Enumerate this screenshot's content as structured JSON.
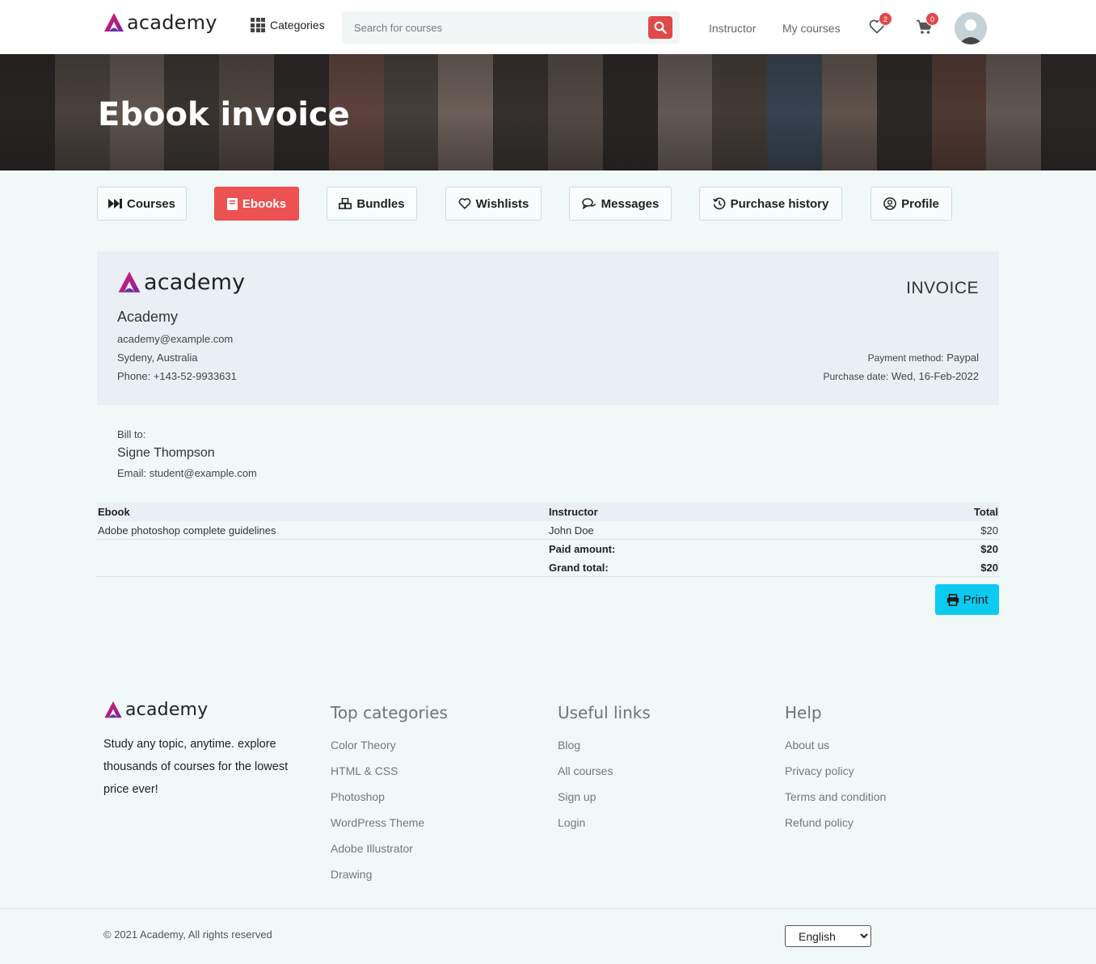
{
  "brand": {
    "name": "academy",
    "logo_colors": [
      "#c2185b",
      "#7b1fa2"
    ]
  },
  "header": {
    "categories_label": "Categories",
    "search_placeholder": "Search for courses",
    "instructor_link": "Instructor",
    "my_courses_link": "My courses",
    "wishlist_count": "2",
    "cart_count": "0"
  },
  "banner": {
    "title": "Ebook invoice"
  },
  "tabs": [
    {
      "label": "Courses"
    },
    {
      "label": "Ebooks",
      "active": true
    },
    {
      "label": "Bundles"
    },
    {
      "label": "Wishlists"
    },
    {
      "label": "Messages"
    },
    {
      "label": "Purchase history"
    },
    {
      "label": "Profile"
    }
  ],
  "invoice": {
    "title": "INVOICE",
    "company": "Academy",
    "email": "academy@example.com",
    "address": "Sydeny, Australia",
    "phone": "Phone: +143-52-9933631",
    "payment_method_label": "Payment method:",
    "payment_method": "Paypal",
    "purchase_date_label": "Purchase date:",
    "purchase_date": "Wed, 16-Feb-2022",
    "bill_to_label": "Bill to:",
    "bill_name": "Signe Thompson",
    "bill_email": "Email: student@example.com",
    "table": {
      "headers": [
        "Ebook",
        "Instructor",
        "Total"
      ],
      "rows": [
        [
          "Adobe photoshop complete guidelines",
          "John Doe",
          "$20"
        ]
      ],
      "paid_label": "Paid amount:",
      "paid_value": "$20",
      "grand_label": "Grand total:",
      "grand_value": "$20"
    },
    "print_label": "Print"
  },
  "footer": {
    "about": "Study any topic, anytime. explore thousands of courses for the lowest price ever!",
    "top_categories": {
      "title": "Top categories",
      "links": [
        "Color Theory",
        "HTML & CSS",
        "Photoshop",
        "WordPress Theme",
        "Adobe Illustrator",
        "Drawing"
      ]
    },
    "useful_links": {
      "title": "Useful links",
      "links": [
        "Blog",
        "All courses",
        "Sign up",
        "Login"
      ]
    },
    "help": {
      "title": "Help",
      "links": [
        "About us",
        "Privacy policy",
        "Terms and condition",
        "Refund policy"
      ]
    },
    "copyright": "© 2021 Academy, All rights reserved",
    "language": "English"
  },
  "colors": {
    "accent": "#ec5252",
    "print": "#0dcaf0",
    "page_bg": "#f1f8f8",
    "invoice_bg": "#eaeff6"
  }
}
